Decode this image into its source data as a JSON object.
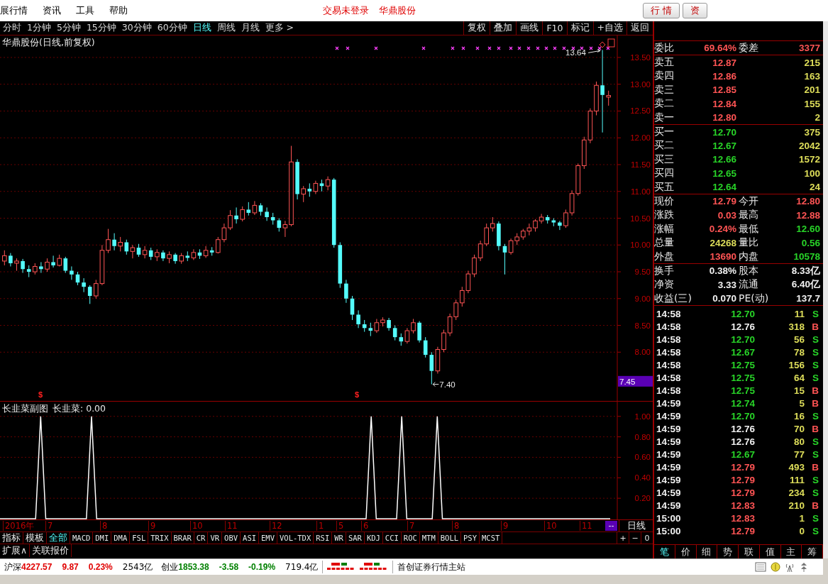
{
  "menu_bar": {
    "items": [
      "展行情",
      "资讯",
      "工具",
      "帮助"
    ],
    "status": [
      "交易未登录",
      "华鼎股份"
    ],
    "buttons": [
      "行 情",
      "资"
    ]
  },
  "period_tabs": [
    {
      "label": "分时",
      "selected": false
    },
    {
      "label": "1分钟",
      "selected": false
    },
    {
      "label": "5分钟",
      "selected": false
    },
    {
      "label": "15分钟",
      "selected": false
    },
    {
      "label": "30分钟",
      "selected": false
    },
    {
      "label": "60分钟",
      "selected": false
    },
    {
      "label": "日线",
      "selected": true
    },
    {
      "label": "周线",
      "selected": false
    },
    {
      "label": "月线",
      "selected": false
    },
    {
      "label": "更多 >",
      "selected": false
    }
  ],
  "chart_tools": [
    "复权",
    "叠加",
    "画线",
    "F10",
    "标记",
    "+自选",
    "返回"
  ],
  "price_chart": {
    "title": "华鼎股份(日线,前复权)",
    "high_label": "13.64",
    "low_label": "7.40",
    "cursor_price": "7.45",
    "signal_marks": [
      "$",
      "$"
    ],
    "chart_data": {
      "type": "candlestick",
      "grid": true,
      "ylim": [
        7.09,
        13.91
      ],
      "yticks": [
        {
          "value": 13.5,
          "label": "13.50"
        },
        {
          "value": 13,
          "label": "13.00"
        },
        {
          "value": 12.5,
          "label": "12.50"
        },
        {
          "value": 12,
          "label": "12.00"
        },
        {
          "value": 11.5,
          "label": "11.50"
        },
        {
          "value": 11,
          "label": "11.00"
        },
        {
          "value": 10.5,
          "label": "10.50"
        },
        {
          "value": 10,
          "label": "10.00"
        },
        {
          "value": 9.5,
          "label": "9.50"
        },
        {
          "value": 9,
          "label": "9.00"
        },
        {
          "value": 8.5,
          "label": "8.50"
        },
        {
          "value": 8,
          "label": "8.00"
        }
      ],
      "ohlc": [
        [
          9.7,
          9.9,
          9.62,
          9.8
        ],
        [
          9.8,
          9.85,
          9.6,
          9.66
        ],
        [
          9.66,
          9.75,
          9.52,
          9.7
        ],
        [
          9.7,
          9.74,
          9.48,
          9.55
        ],
        [
          9.55,
          9.62,
          9.4,
          9.5
        ],
        [
          9.5,
          9.66,
          9.45,
          9.6
        ],
        [
          9.6,
          9.68,
          9.48,
          9.55
        ],
        [
          9.55,
          9.75,
          9.5,
          9.68
        ],
        [
          9.68,
          9.8,
          9.58,
          9.62
        ],
        [
          9.62,
          9.82,
          9.6,
          9.75
        ],
        [
          9.75,
          9.78,
          9.48,
          9.52
        ],
        [
          9.52,
          9.6,
          9.35,
          9.45
        ],
        [
          9.45,
          9.5,
          9.25,
          9.3
        ],
        [
          9.3,
          9.38,
          9.12,
          9.22
        ],
        [
          9.22,
          9.25,
          8.9,
          9.05
        ],
        [
          9.05,
          9.35,
          9.0,
          9.28
        ],
        [
          9.28,
          10.0,
          9.25,
          9.9
        ],
        [
          9.9,
          10.3,
          9.85,
          10.1
        ],
        [
          10.1,
          10.22,
          9.9,
          9.98
        ],
        [
          9.98,
          10.15,
          9.88,
          10.05
        ],
        [
          10.05,
          10.1,
          9.82,
          9.88
        ],
        [
          9.88,
          10.0,
          9.75,
          9.95
        ],
        [
          9.95,
          10.02,
          9.78,
          9.82
        ],
        [
          9.82,
          9.98,
          9.75,
          9.9
        ],
        [
          9.9,
          9.95,
          9.72,
          9.78
        ],
        [
          9.78,
          9.92,
          9.7,
          9.86
        ],
        [
          9.86,
          9.9,
          9.7,
          9.75
        ],
        [
          9.75,
          9.88,
          9.66,
          9.82
        ],
        [
          9.82,
          9.85,
          9.65,
          9.7
        ],
        [
          9.7,
          9.85,
          9.65,
          9.8
        ],
        [
          9.8,
          9.88,
          9.7,
          9.76
        ],
        [
          9.76,
          9.92,
          9.72,
          9.86
        ],
        [
          9.86,
          9.92,
          9.74,
          9.8
        ],
        [
          9.8,
          9.98,
          9.76,
          9.9
        ],
        [
          9.9,
          9.96,
          9.8,
          9.86
        ],
        [
          9.86,
          10.15,
          9.84,
          10.1
        ],
        [
          10.1,
          10.4,
          10.05,
          10.32
        ],
        [
          10.32,
          10.65,
          10.28,
          10.55
        ],
        [
          10.55,
          10.7,
          10.4,
          10.48
        ],
        [
          10.48,
          10.72,
          10.44,
          10.66
        ],
        [
          10.66,
          10.8,
          10.55,
          10.6
        ],
        [
          10.6,
          10.82,
          10.56,
          10.74
        ],
        [
          10.74,
          10.78,
          10.55,
          10.62
        ],
        [
          10.62,
          10.7,
          10.45,
          10.52
        ],
        [
          10.52,
          10.6,
          10.38,
          10.46
        ],
        [
          10.46,
          10.5,
          10.25,
          10.32
        ],
        [
          10.32,
          10.45,
          10.15,
          10.38
        ],
        [
          10.38,
          11.85,
          10.35,
          11.55
        ],
        [
          11.55,
          11.6,
          10.85,
          10.95
        ],
        [
          10.95,
          11.1,
          10.8,
          11.05
        ],
        [
          11.05,
          11.15,
          10.9,
          11.0
        ],
        [
          11.0,
          11.2,
          10.95,
          11.15
        ],
        [
          11.15,
          11.22,
          11.0,
          11.1
        ],
        [
          11.1,
          11.28,
          11.02,
          11.22
        ],
        [
          11.22,
          11.25,
          9.95,
          10.0
        ],
        [
          10.0,
          10.05,
          9.2,
          9.28
        ],
        [
          9.28,
          9.35,
          8.92,
          9.0
        ],
        [
          9.0,
          9.05,
          8.6,
          8.7
        ],
        [
          8.7,
          8.78,
          8.45,
          8.52
        ],
        [
          8.52,
          8.6,
          8.38,
          8.45
        ],
        [
          8.45,
          8.55,
          8.3,
          8.4
        ],
        [
          8.4,
          8.62,
          8.36,
          8.55
        ],
        [
          8.55,
          8.65,
          8.48,
          8.6
        ],
        [
          8.6,
          8.64,
          8.4,
          8.45
        ],
        [
          8.45,
          8.5,
          8.22,
          8.28
        ],
        [
          8.28,
          8.35,
          8.12,
          8.2
        ],
        [
          8.2,
          8.45,
          8.16,
          8.4
        ],
        [
          8.4,
          8.62,
          8.35,
          8.55
        ],
        [
          8.55,
          8.58,
          8.18,
          8.22
        ],
        [
          8.22,
          8.28,
          7.9,
          7.95
        ],
        [
          7.95,
          8.0,
          7.4,
          7.65
        ],
        [
          7.65,
          8.1,
          7.6,
          8.05
        ],
        [
          8.05,
          8.42,
          8.0,
          8.36
        ],
        [
          8.36,
          8.72,
          8.3,
          8.66
        ],
        [
          8.66,
          8.98,
          8.6,
          8.92
        ],
        [
          8.92,
          9.22,
          8.85,
          9.15
        ],
        [
          9.15,
          9.52,
          9.1,
          9.46
        ],
        [
          9.46,
          9.82,
          9.4,
          9.76
        ],
        [
          9.76,
          10.08,
          9.7,
          10.02
        ],
        [
          10.02,
          10.4,
          9.98,
          10.32
        ],
        [
          10.32,
          10.52,
          10.25,
          10.4
        ],
        [
          10.4,
          10.44,
          9.9,
          9.98
        ],
        [
          9.98,
          10.02,
          9.45,
          9.86
        ],
        [
          9.86,
          10.12,
          9.82,
          10.08
        ],
        [
          10.08,
          10.22,
          10.0,
          10.15
        ],
        [
          10.15,
          10.3,
          10.1,
          10.26
        ],
        [
          10.26,
          10.4,
          10.18,
          10.32
        ],
        [
          10.32,
          10.48,
          10.25,
          10.45
        ],
        [
          10.45,
          10.58,
          10.4,
          10.52
        ],
        [
          10.52,
          10.56,
          10.4,
          10.46
        ],
        [
          10.46,
          10.5,
          10.35,
          10.42
        ],
        [
          10.42,
          10.45,
          10.28,
          10.36
        ],
        [
          10.36,
          10.66,
          10.32,
          10.6
        ],
        [
          10.6,
          11.02,
          10.55,
          10.96
        ],
        [
          10.96,
          11.52,
          10.92,
          11.48
        ],
        [
          11.48,
          12.02,
          11.42,
          11.96
        ],
        [
          11.96,
          12.55,
          11.9,
          12.5
        ],
        [
          12.5,
          13.05,
          12.42,
          12.98
        ],
        [
          12.98,
          13.64,
          12.1,
          12.8
        ],
        [
          12.76,
          12.88,
          12.6,
          12.79
        ]
      ]
    }
  },
  "indicator_chart": {
    "title": "长韭菜副图",
    "reading": ": 0.00",
    "chart_data": {
      "type": "line",
      "grid": true,
      "ylim": [
        0,
        1.13
      ],
      "yticks": [
        {
          "value": 1,
          "label": "1.00"
        },
        {
          "value": 0.8,
          "label": "0.80"
        },
        {
          "value": 0.6,
          "label": "0.60"
        },
        {
          "value": 0.4,
          "label": "0.40"
        },
        {
          "value": 0.2,
          "label": "0.20"
        }
      ],
      "series": [
        {
          "name": "长韭菜",
          "color": "#ffffff",
          "values": [
            0,
            0,
            0,
            0,
            0,
            0,
            0,
            0,
            1,
            0,
            0,
            0,
            0,
            0,
            0,
            0,
            0,
            0,
            1,
            0,
            0,
            0,
            0,
            0,
            0,
            0,
            0,
            0,
            0,
            0,
            0,
            0,
            0,
            0,
            0,
            0,
            0,
            0,
            0,
            0,
            0,
            0,
            0,
            0,
            0,
            0,
            0,
            0,
            0,
            0,
            0,
            0,
            0,
            0,
            0,
            0,
            0,
            0,
            0,
            0,
            0,
            0,
            0,
            0,
            0,
            0,
            0,
            0,
            0,
            0,
            0,
            0,
            0,
            1,
            0,
            0,
            0,
            0,
            0,
            1,
            0,
            0,
            0,
            0,
            0,
            0,
            1,
            0,
            0,
            0,
            0,
            0,
            0,
            0,
            0,
            0,
            0,
            0,
            0,
            0,
            0,
            0,
            0,
            0,
            0,
            0,
            0,
            0,
            0,
            0,
            0,
            0,
            0,
            0,
            0,
            0,
            0,
            0,
            0,
            0,
            0
          ]
        }
      ]
    }
  },
  "x_axis": {
    "labels": [
      "2016年",
      "7",
      "8",
      "9",
      "10",
      "11",
      "12",
      "1",
      "5",
      "6",
      "7",
      "8",
      "9",
      "10",
      "11"
    ],
    "end_marker": "--",
    "period": "日线"
  },
  "indicator_tabs": [
    {
      "label": "指标",
      "selected": false
    },
    {
      "label": "模板",
      "selected": false
    },
    {
      "label": "全部",
      "selected": true
    },
    {
      "label": "MACD",
      "selected": false
    },
    {
      "label": "DMI",
      "selected": false
    },
    {
      "label": "DMA",
      "selected": false
    },
    {
      "label": "FSL",
      "selected": false
    },
    {
      "label": "TRIX",
      "selected": false
    },
    {
      "label": "BRAR",
      "selected": false
    },
    {
      "label": "CR",
      "selected": false
    },
    {
      "label": "VR",
      "selected": false
    },
    {
      "label": "OBV",
      "selected": false
    },
    {
      "label": "ASI",
      "selected": false
    },
    {
      "label": "EMV",
      "selected": false
    },
    {
      "label": "VOL-TDX",
      "selected": false
    },
    {
      "label": "RSI",
      "selected": false
    },
    {
      "label": "WR",
      "selected": false
    },
    {
      "label": "SAR",
      "selected": false
    },
    {
      "label": "KDJ",
      "selected": false
    },
    {
      "label": "CCI",
      "selected": false
    },
    {
      "label": "ROC",
      "selected": false
    },
    {
      "label": "MTM",
      "selected": false
    },
    {
      "label": "BOLL",
      "selected": false
    },
    {
      "label": "PSY",
      "selected": false
    },
    {
      "label": "MCST",
      "selected": false
    }
  ],
  "zoom_buttons": [
    "+",
    "−",
    "0"
  ],
  "extra_tabs": [
    "扩展∧",
    "关联报价"
  ],
  "quote_panel": {
    "ratio": [
      {
        "label": "委比",
        "value": "69.64%",
        "color": "#ff5454"
      },
      {
        "label": "委差",
        "value": "3377",
        "color": "#ff5454"
      }
    ],
    "asks": [
      {
        "label": "卖五",
        "price": "12.87",
        "volume": "215"
      },
      {
        "label": "卖四",
        "price": "12.86",
        "volume": "163"
      },
      {
        "label": "卖三",
        "price": "12.85",
        "volume": "201"
      },
      {
        "label": "卖二",
        "price": "12.84",
        "volume": "155"
      },
      {
        "label": "卖一",
        "price": "12.80",
        "volume": "2"
      }
    ],
    "bids": [
      {
        "label": "买一",
        "price": "12.70",
        "volume": "375"
      },
      {
        "label": "买二",
        "price": "12.67",
        "volume": "2042"
      },
      {
        "label": "买三",
        "price": "12.66",
        "volume": "1572"
      },
      {
        "label": "买四",
        "price": "12.65",
        "volume": "100"
      },
      {
        "label": "买五",
        "price": "12.64",
        "volume": "24"
      }
    ],
    "stats": [
      [
        {
          "label": "现价",
          "value": "12.79",
          "color": "#ff5454"
        },
        {
          "label": "今开",
          "value": "12.80",
          "color": "#ff5454"
        }
      ],
      [
        {
          "label": "涨跌",
          "value": "0.03",
          "color": "#ff5454"
        },
        {
          "label": "最高",
          "value": "12.88",
          "color": "#ff5454"
        }
      ],
      [
        {
          "label": "涨幅",
          "value": "0.24%",
          "color": "#ff5454"
        },
        {
          "label": "最低",
          "value": "12.60",
          "color": "#28d428"
        }
      ],
      [
        {
          "label": "总量",
          "value": "24268",
          "color": "#dede5a"
        },
        {
          "label": "量比",
          "value": "0.56",
          "color": "#28d428"
        }
      ],
      [
        {
          "label": "外盘",
          "value": "13690",
          "color": "#ff5454"
        },
        {
          "label": "内盘",
          "value": "10578",
          "color": "#28d428"
        }
      ],
      [
        {
          "label": "换手",
          "value": "0.38%",
          "color": "#f0f0f0"
        },
        {
          "label": "股本",
          "value": "8.33亿",
          "color": "#f0f0f0"
        }
      ],
      [
        {
          "label": "净资",
          "value": "3.33",
          "color": "#f0f0f0"
        },
        {
          "label": "流通",
          "value": "6.40亿",
          "color": "#f0f0f0"
        }
      ],
      [
        {
          "label": "收益(三)",
          "value": "0.070",
          "color": "#f0f0f0"
        },
        {
          "label": "PE(动)",
          "value": "137.7",
          "color": "#f0f0f0"
        }
      ]
    ],
    "trades": [
      {
        "time": "14:58",
        "price": "12.70",
        "color": "#28d428",
        "volume": "11",
        "side": "S",
        "kind": "sell"
      },
      {
        "time": "14:58",
        "price": "12.76",
        "color": "#f0f0f0",
        "volume": "318",
        "side": "B",
        "kind": "buy"
      },
      {
        "time": "14:58",
        "price": "12.70",
        "color": "#28d428",
        "volume": "56",
        "side": "S",
        "kind": "sell"
      },
      {
        "time": "14:58",
        "price": "12.67",
        "color": "#28d428",
        "volume": "78",
        "side": "S",
        "kind": "sell"
      },
      {
        "time": "14:58",
        "price": "12.75",
        "color": "#28d428",
        "volume": "156",
        "side": "S",
        "kind": "sell"
      },
      {
        "time": "14:58",
        "price": "12.75",
        "color": "#28d428",
        "volume": "64",
        "side": "S",
        "kind": "sell"
      },
      {
        "time": "14:58",
        "price": "12.75",
        "color": "#28d428",
        "volume": "15",
        "side": "B",
        "kind": "buy"
      },
      {
        "time": "14:59",
        "price": "12.74",
        "color": "#28d428",
        "volume": "5",
        "side": "B",
        "kind": "buy"
      },
      {
        "time": "14:59",
        "price": "12.70",
        "color": "#28d428",
        "volume": "16",
        "side": "S",
        "kind": "sell"
      },
      {
        "time": "14:59",
        "price": "12.76",
        "color": "#f0f0f0",
        "volume": "70",
        "side": "B",
        "kind": "buy"
      },
      {
        "time": "14:59",
        "price": "12.76",
        "color": "#f0f0f0",
        "volume": "80",
        "side": "S",
        "kind": "sell"
      },
      {
        "time": "14:59",
        "price": "12.67",
        "color": "#28d428",
        "volume": "77",
        "side": "S",
        "kind": "sell"
      },
      {
        "time": "14:59",
        "price": "12.79",
        "color": "#ff5454",
        "volume": "493",
        "side": "B",
        "kind": "buy"
      },
      {
        "time": "14:59",
        "price": "12.79",
        "color": "#ff5454",
        "volume": "111",
        "side": "S",
        "kind": "sell"
      },
      {
        "time": "14:59",
        "price": "12.79",
        "color": "#ff5454",
        "volume": "234",
        "side": "S",
        "kind": "sell"
      },
      {
        "time": "14:59",
        "price": "12.83",
        "color": "#ff5454",
        "volume": "210",
        "side": "B",
        "kind": "buy"
      },
      {
        "time": "15:00",
        "price": "12.83",
        "color": "#ff5454",
        "volume": "1",
        "side": "S",
        "kind": "sell"
      },
      {
        "time": "15:00",
        "price": "12.79",
        "color": "#ff5454",
        "volume": "0",
        "side": "S",
        "kind": "sell"
      }
    ],
    "tabs": [
      {
        "label": "笔",
        "selected": true
      },
      {
        "label": "价",
        "selected": false
      },
      {
        "label": "细",
        "selected": false
      },
      {
        "label": "势",
        "selected": false
      },
      {
        "label": "联",
        "selected": false
      },
      {
        "label": "值",
        "selected": false
      },
      {
        "label": "主",
        "selected": false
      },
      {
        "label": "筹",
        "selected": false
      }
    ]
  },
  "status_bar": {
    "indices": [
      {
        "name": "沪深",
        "value": "4227.57",
        "change": "9.87",
        "percent": "0.23%",
        "turnover": "2543亿",
        "color": "#e00000"
      },
      {
        "name": "创业",
        "value": "1853.38",
        "change": "-3.58",
        "percent": "-0.19%",
        "turnover": "719.4亿",
        "color": "#008000"
      }
    ],
    "server": "首创证券行情主站"
  }
}
